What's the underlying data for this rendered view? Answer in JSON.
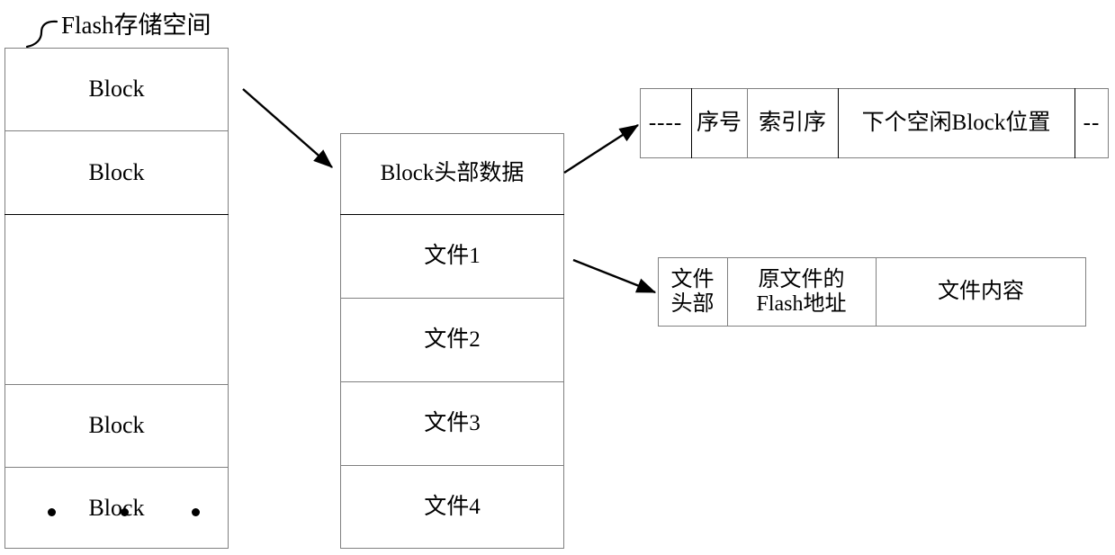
{
  "diagram": {
    "caption": "Flash存储空间",
    "flash_column": {
      "rows": [
        {
          "label": "Block",
          "kind": "text"
        },
        {
          "label": "Block",
          "kind": "text"
        },
        {
          "label": "",
          "kind": "ellipsis-dots"
        },
        {
          "label": "Block",
          "kind": "text"
        },
        {
          "label": "Block",
          "kind": "text"
        }
      ]
    },
    "block_column": {
      "rows": [
        {
          "label": "Block头部数据"
        },
        {
          "label": "文件1"
        },
        {
          "label": "文件2"
        },
        {
          "label": "文件3"
        },
        {
          "label": "文件4"
        }
      ]
    },
    "header_table": {
      "cells": [
        {
          "label": "----"
        },
        {
          "label": "序号"
        },
        {
          "label": "索引序"
        },
        {
          "label": "下个空闲Block位置"
        },
        {
          "label": "--"
        }
      ]
    },
    "file_table": {
      "cells": [
        {
          "label": "文件\n头部"
        },
        {
          "label": "原文件的\nFlash地址"
        },
        {
          "label": "文件内容"
        }
      ]
    },
    "colors": {
      "stroke": "#808080",
      "strong_stroke": "#000000",
      "arrow": "#000000",
      "background": "#ffffff"
    }
  }
}
